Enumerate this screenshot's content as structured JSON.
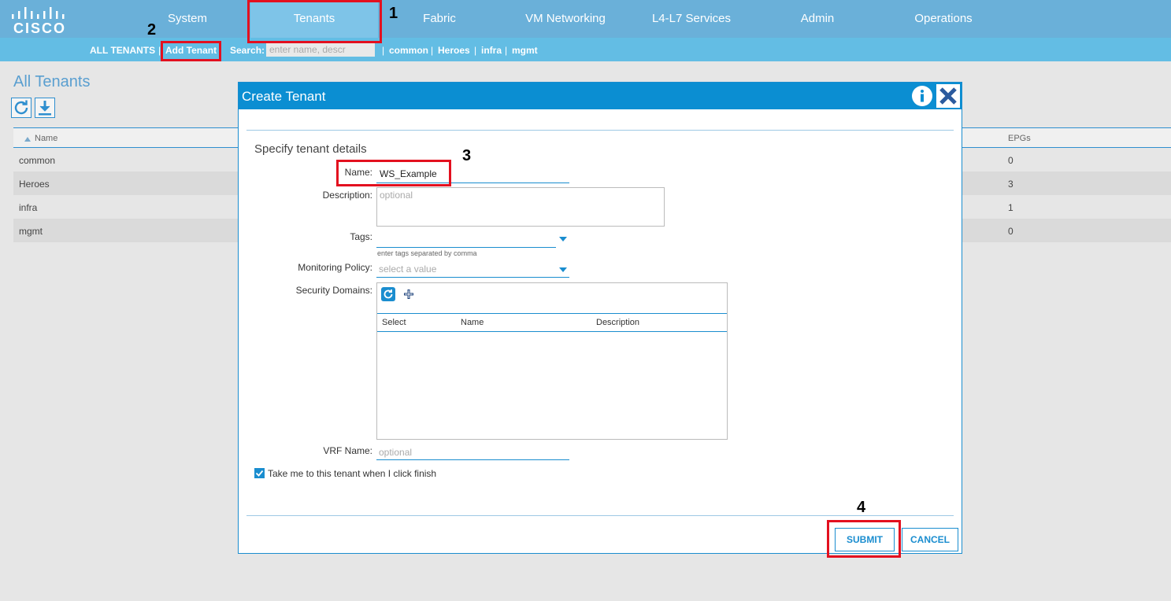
{
  "brand": {
    "logo_text": "CISCO"
  },
  "nav": {
    "tabs": [
      {
        "label": "System"
      },
      {
        "label": "Tenants"
      },
      {
        "label": "Fabric"
      },
      {
        "label": "VM Networking"
      },
      {
        "label": "L4-L7 Services"
      },
      {
        "label": "Admin"
      },
      {
        "label": "Operations"
      }
    ],
    "active_tab": "Tenants"
  },
  "subnav": {
    "all_tenants": "ALL TENANTS",
    "sep": "|",
    "add_tenant": "Add Tenant",
    "search_label": "Search:",
    "search_placeholder": "enter name, descr",
    "quick_links": [
      "common",
      "Heroes",
      "infra",
      "mgmt"
    ]
  },
  "page": {
    "title": "All Tenants",
    "table": {
      "columns": [
        "Name",
        "EPGs"
      ],
      "rows": [
        {
          "name": "common",
          "epgs": "0"
        },
        {
          "name": "Heroes",
          "epgs": "3"
        },
        {
          "name": "infra",
          "epgs": "1"
        },
        {
          "name": "mgmt",
          "epgs": "0"
        }
      ]
    }
  },
  "dialog": {
    "title": "Create Tenant",
    "section_title": "Specify tenant details",
    "fields": {
      "name": {
        "label": "Name:",
        "value": "WS_Example"
      },
      "description": {
        "label": "Description:",
        "placeholder": "optional"
      },
      "tags": {
        "label": "Tags:",
        "hint": "enter tags separated by comma"
      },
      "monitoring_policy": {
        "label": "Monitoring Policy:",
        "placeholder": "select a value"
      },
      "security_domains": {
        "label": "Security Domains:",
        "columns": [
          "Select",
          "Name",
          "Description"
        ]
      },
      "vrf_name": {
        "label": "VRF Name:",
        "placeholder": "optional"
      }
    },
    "checkbox": {
      "label": "Take me to this tenant when I click finish",
      "checked": true
    },
    "submit_label": "SUBMIT",
    "cancel_label": "CANCEL"
  },
  "annotations": {
    "step1": "1",
    "step2": "2",
    "step3": "3",
    "step4": "4"
  },
  "colors": {
    "nav": "#6ab0d9",
    "subnav": "#63bde4",
    "accent": "#1a8dcf",
    "annotation": "#e3101f"
  }
}
